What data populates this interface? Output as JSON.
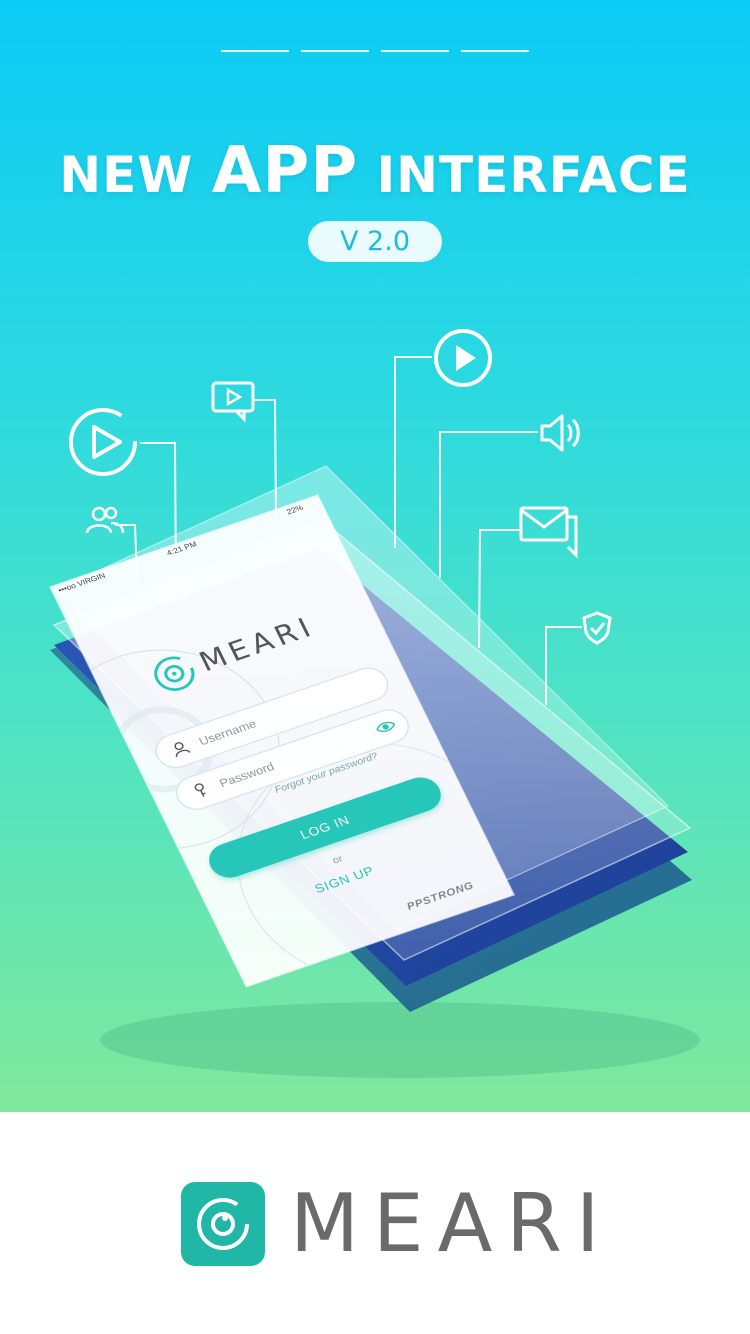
{
  "header": {
    "headline_part1": "NEW",
    "headline_part2": "APP",
    "headline_part3": "INTERFACE",
    "version": "V 2.0"
  },
  "phone": {
    "status_carrier": "•••oo VIRGIN",
    "status_time": "4:21 PM",
    "status_battery": "22%",
    "logo_text": "MEARI",
    "username_placeholder": "Username",
    "password_placeholder": "Password",
    "forgot_link": "Forgot your password?",
    "login_button": "LOG IN",
    "or_text": "or",
    "signup_link": "SIGN UP",
    "brand": "PPSTRONG"
  },
  "floating_icons": [
    "play-icon",
    "video-message-icon",
    "users-icon",
    "play-icon",
    "speaker-icon",
    "message-icon",
    "shield-check-icon"
  ],
  "footer": {
    "wordmark": "MEARI"
  },
  "colors": {
    "accent": "#26c6b8",
    "sky_top": "#0ccbf6",
    "sky_bottom": "#80e89c",
    "wordmark": "#6a6a6a"
  }
}
